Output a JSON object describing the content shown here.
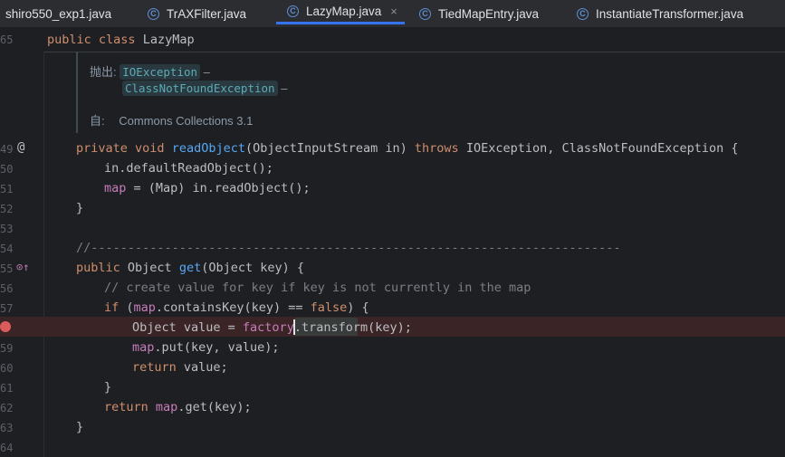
{
  "tabs": [
    {
      "label": "shiro550_exp1.java",
      "active": false,
      "icon": "class-icon"
    },
    {
      "label": "TrAXFilter.java",
      "active": false,
      "icon": "class-icon"
    },
    {
      "label": "LazyMap.java",
      "active": true,
      "icon": "class-icon",
      "close": "×"
    },
    {
      "label": "TiedMapEntry.java",
      "active": false,
      "icon": "class-icon"
    },
    {
      "label": "InstantiateTransformer.java",
      "active": false,
      "icon": "class-icon"
    }
  ],
  "sticky": {
    "line": "65",
    "kw": "public class",
    "name": "LazyMap"
  },
  "doc": {
    "throws_label": "抛出:",
    "throws": [
      "IOException",
      "ClassNotFoundException"
    ],
    "dash": "–",
    "since_label": "自:",
    "since": "Commons Collections 3.1"
  },
  "lines": [
    "49",
    "50",
    "51",
    "52",
    "53",
    "54",
    "55",
    "56",
    "57",
    "58",
    "59",
    "60",
    "61",
    "62",
    "63",
    "64"
  ],
  "gutter_marks": {
    "override": "@",
    "implements": "⊙↑"
  },
  "code": {
    "l49": {
      "kw1": "private",
      "kw2": "void",
      "fn": "readObject",
      "args": "(ObjectInputStream in) ",
      "kw3": "throws",
      "rest": " IOException, ClassNotFoundException {"
    },
    "l50": "in.defaultReadObject();",
    "l51": {
      "fld": "map",
      "rest": " = (Map) in.readObject();"
    },
    "l52": "}",
    "l54": "//------------------------------------------------------------------------",
    "l55": {
      "kw": "public",
      "type": " Object ",
      "fn": "get",
      "rest": "(Object key) {"
    },
    "l56": "// create value for key if key is not currently in the map",
    "l57": {
      "kw": "if",
      "p1": " (",
      "fld": "map",
      "p2": ".containsKey(key) == ",
      "kw2": "false",
      "p3": ") {"
    },
    "l58": {
      "a": "Object value = ",
      "fld": "factory",
      "b": ".",
      "c": "transform",
      "d": "(key);"
    },
    "l59": {
      "fld": "map",
      "rest": ".put(key, value);"
    },
    "l60": {
      "kw": "return",
      "rest": " value;"
    },
    "l61": "}",
    "l62": {
      "kw": "return",
      "sp": " ",
      "fld": "map",
      "rest": ".get(key);"
    },
    "l63": "}"
  },
  "colors": {
    "keyword": "#cf8e6d",
    "function": "#56a8f5",
    "field": "#c77dbb",
    "comment": "#7a7e85",
    "breakpoint": "#db5c5c",
    "tab_underline": "#3574f0"
  }
}
